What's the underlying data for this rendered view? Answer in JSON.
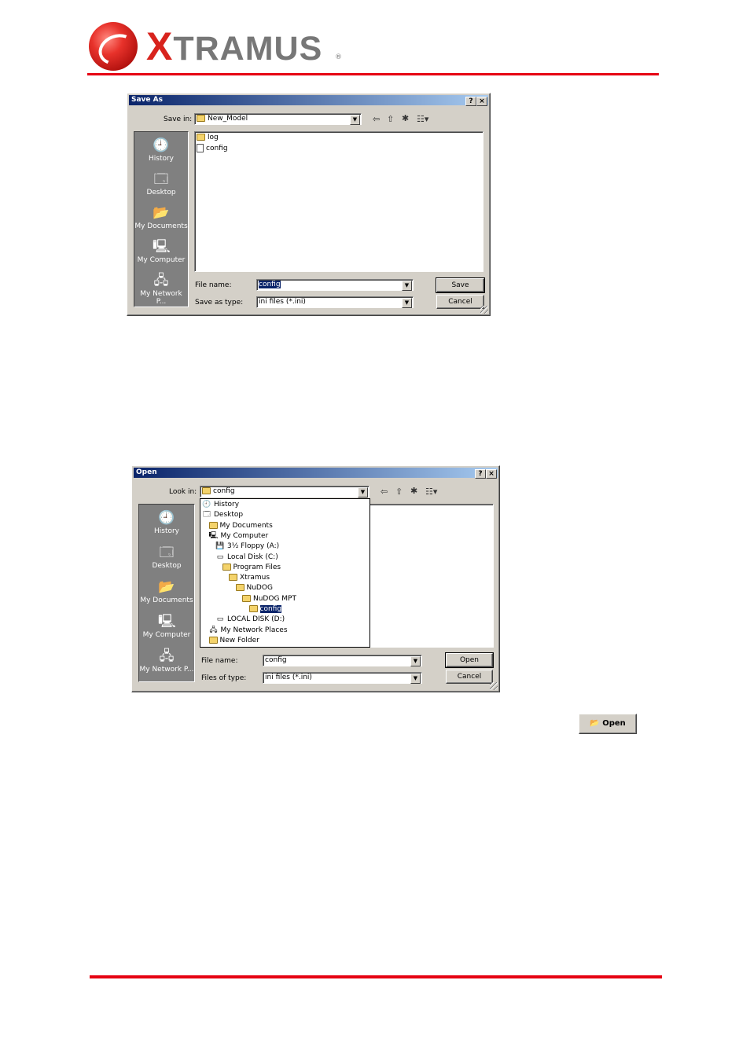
{
  "header": {
    "brand_initial": "X",
    "brand_rest": "TRAMUS",
    "brand_reg": "®"
  },
  "save_dialog": {
    "title": "Save As",
    "help_btn": "?",
    "close_btn": "×",
    "save_in_label": "Save in:",
    "save_in_value": "New_Model",
    "places": [
      "History",
      "Desktop",
      "My Documents",
      "My Computer",
      "My Network P..."
    ],
    "files": [
      {
        "name": "log",
        "type": "folder"
      },
      {
        "name": "config",
        "type": "file"
      }
    ],
    "file_name_label": "File name:",
    "file_name_value": "config",
    "file_type_label": "Save as type:",
    "file_type_value": "ini files (*.ini)",
    "save_button": "Save",
    "cancel_button": "Cancel"
  },
  "open_dialog": {
    "title": "Open",
    "help_btn": "?",
    "close_btn": "×",
    "look_in_label": "Look in:",
    "look_in_value": "config",
    "places": [
      "History",
      "Desktop",
      "My Documents",
      "My Computer",
      "My Network P..."
    ],
    "tree": [
      {
        "label": "History",
        "indent": 0,
        "icon": "history-icon"
      },
      {
        "label": "Desktop",
        "indent": 0,
        "icon": "desktop-icon"
      },
      {
        "label": "My Documents",
        "indent": 1,
        "icon": "folder-icon"
      },
      {
        "label": "My Computer",
        "indent": 1,
        "icon": "computer-icon"
      },
      {
        "label": "3½ Floppy (A:)",
        "indent": 2,
        "icon": "floppy-icon"
      },
      {
        "label": "Local Disk (C:)",
        "indent": 2,
        "icon": "disk-icon"
      },
      {
        "label": "Program Files",
        "indent": 3,
        "icon": "folder-icon"
      },
      {
        "label": "Xtramus",
        "indent": 4,
        "icon": "folder-icon"
      },
      {
        "label": "NuDOG",
        "indent": 5,
        "icon": "folder-icon"
      },
      {
        "label": "NuDOG MPT",
        "indent": 6,
        "icon": "folder-icon"
      },
      {
        "label": "config",
        "indent": 7,
        "icon": "folder-open-icon",
        "selected": true
      },
      {
        "label": "LOCAL DISK (D:)",
        "indent": 2,
        "icon": "disk-icon"
      },
      {
        "label": "My Network Places",
        "indent": 1,
        "icon": "network-icon"
      },
      {
        "label": "New Folder",
        "indent": 1,
        "icon": "folder-icon"
      }
    ],
    "file_name_label": "File name:",
    "file_name_value": "config",
    "file_type_label": "Files of type:",
    "file_type_value": "ini files (*.ini)",
    "open_button": "Open",
    "cancel_button": "Cancel"
  },
  "open_toolbar_button": {
    "label": "Open"
  }
}
